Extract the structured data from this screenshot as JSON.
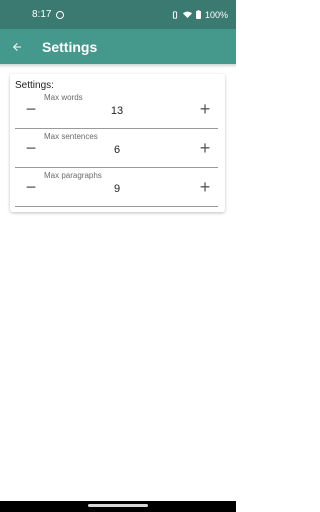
{
  "status_bar": {
    "time": "8:17",
    "battery": "100%",
    "icons": [
      "vibrate-icon",
      "wifi-icon",
      "battery-icon"
    ]
  },
  "app_bar": {
    "title": "Settings",
    "back_icon": "arrow-back-icon"
  },
  "settings": {
    "heading": "Settings:",
    "decrement_symbol": "−",
    "increment_symbol": "+",
    "items": [
      {
        "label": "Max words",
        "value": "13"
      },
      {
        "label": "Max sentences",
        "value": "6"
      },
      {
        "label": "Max paragraphs",
        "value": "9"
      }
    ]
  },
  "colors": {
    "status_bar": "#3a7a70",
    "app_bar": "#45998c"
  }
}
